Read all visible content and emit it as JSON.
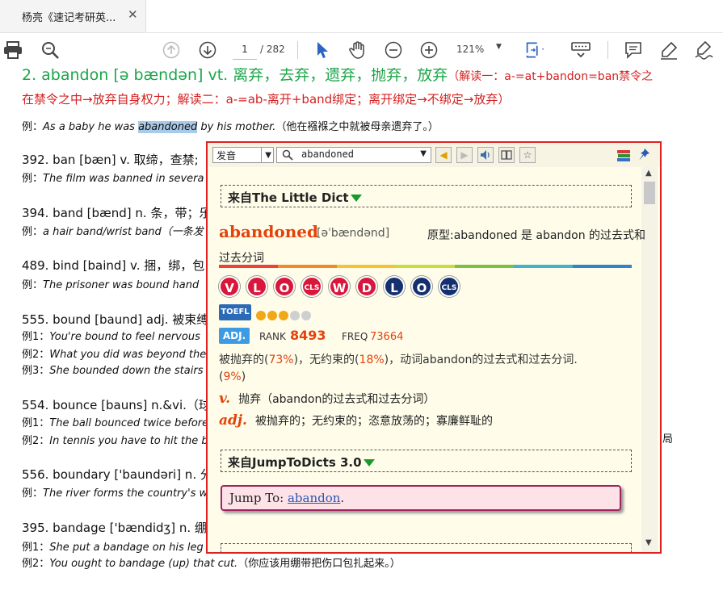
{
  "tab": {
    "title": "杨亮《速记考研英...",
    "close": "✕"
  },
  "toolbar": {
    "page_current": "1",
    "page_total": "/ 282",
    "zoom": "121%"
  },
  "document": {
    "line1": "2. abandon [ə bændən] vt. 离弃，去弃，遗弃，抛弃，放弃",
    "line1_tail": "（解读一：a-=at+bandon=ban禁令之",
    "line2": "在禁令之中→放弃自身权力；解读二：a-=ab-离开+band绑定；离开绑定→不绑定→放弃）",
    "ex1_pre": "例：",
    "ex1_a": "As a baby he was ",
    "ex1_hl": "abandoned",
    "ex1_b": " by his mother.",
    "ex1_cn": "（他在襁褓之中就被母亲遗弃了。）",
    "e392": "392. ban [bæn] v. 取缔，查禁;",
    "e392_ex": "The film was banned in severa",
    "e394": "394. band [bænd] n. 条，带；乐",
    "e394_ex": "a hair band/wrist band（一条发",
    "e489": "489. bind [baind] v. 捆，绑，包",
    "e489_ex": "The prisoner was bound hand",
    "e555": "555. bound [baund] adj. 被束缚",
    "e555_ex1": "You're bound to feel nervous",
    "e555_ex2": "What you did was beyond the",
    "e555_ex3": "She bounded down the stairs",
    "e554": "554. bounce [bauns] n.&vi.（球",
    "e554_ex1": "The ball bounced twice before",
    "e554_ex2": "In tennis you have to hit the b",
    "e556": "556. boundary ['baundəri] n. 分",
    "e556_ex": "The river forms the country's w",
    "e395": "395. bandage ['bændidʒ] n. 绷带",
    "e395_ex1": "She put a bandage on his leg",
    "e395_ex2": "You ought to bandage (up) that cut.",
    "e395_ex2_cn": "（你应该用绷带把伤口包扎起来。）",
    "tail_cn": "局",
    "ex_prefix": "例：",
    "ex_prefix1": "例1：",
    "ex_prefix2": "例2：",
    "ex_prefix3": "例3："
  },
  "popup": {
    "voice_select": "发音",
    "search_value": "abandoned",
    "section1": "来自The Little Dict",
    "headword": "abandoned",
    "phonetic": "[əˈbændənd]",
    "origin": "原型:abandoned 是 abandon 的过去式和",
    "origin2": "过去分词",
    "badges": [
      "V",
      "L",
      "O",
      "CLS",
      "W",
      "D",
      "L",
      "O",
      "CLS"
    ],
    "toefl": "TOEFL",
    "adj_badge": "ADJ.",
    "rank_label": "RANK",
    "rank_value": "8493",
    "freq_label": "FREQ",
    "freq_value": "73664",
    "stats_a": "被抛弃的(",
    "stats_p1": "73%",
    "stats_b": ")，无约束的(",
    "stats_p2": "18%",
    "stats_c": ")，动词abandon的过去式和过去分词.",
    "stats_d": "(",
    "stats_p3": "9%",
    "stats_e": ")",
    "pos_v": "v.",
    "def_v": "抛弃（abandon的过去式和过去分词）",
    "pos_adj": "adj.",
    "def_adj": "被抛弃的；无约束的；恣意放荡的；寡廉鲜耻的",
    "section2": "来自JumpToDicts 3.0",
    "jump_label": "Jump To: ",
    "jump_link": "abandon",
    "jump_end": "."
  },
  "colors": {
    "accent_red": "#e3420b",
    "popup_border": "#e02020",
    "popup_bg": "#fffdea"
  }
}
